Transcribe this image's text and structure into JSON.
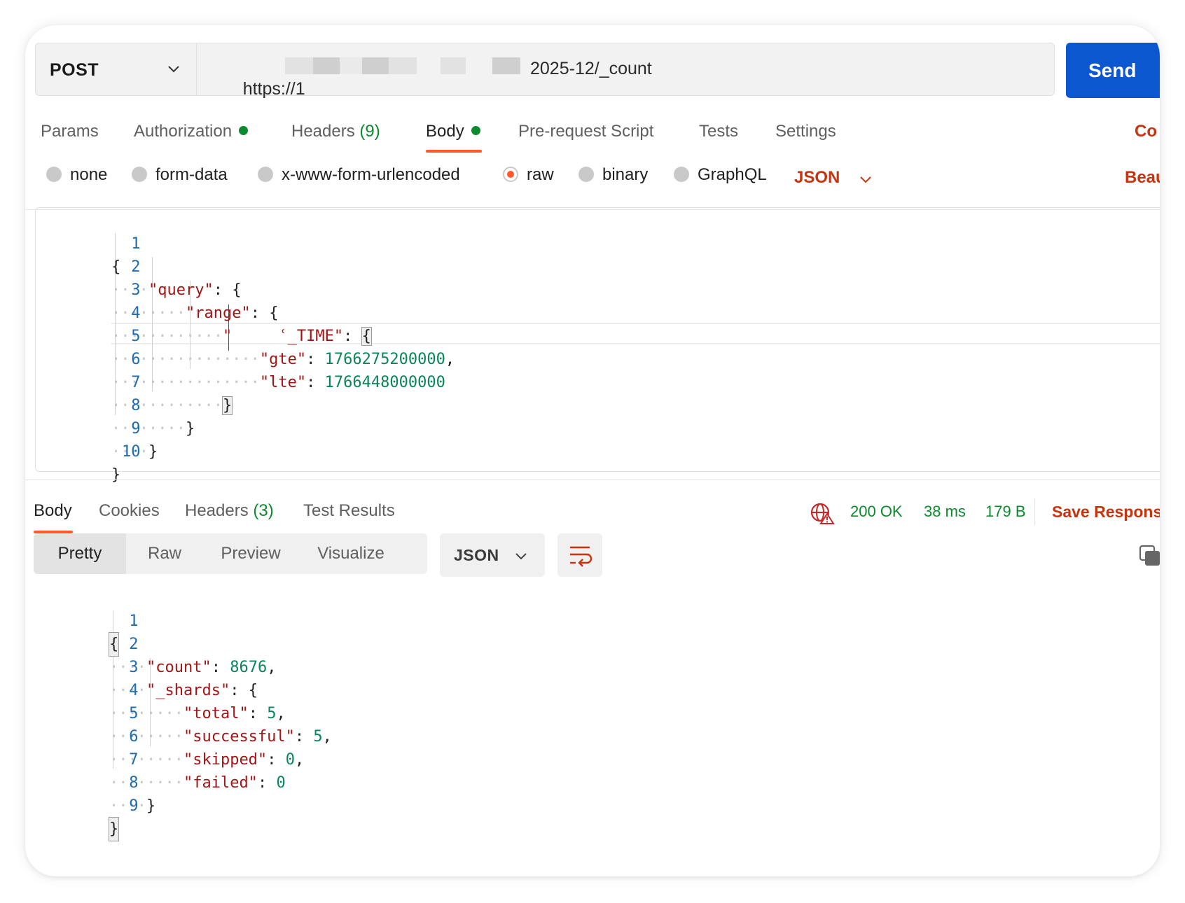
{
  "request": {
    "method": "POST",
    "url_start": "https://1",
    "url_end": "2025-12/_count",
    "send_label": "Send"
  },
  "request_tabs": {
    "params": "Params",
    "authorization": "Authorization",
    "headers": "Headers",
    "headers_count": "(9)",
    "body": "Body",
    "pre_request": "Pre-request Script",
    "tests": "Tests",
    "settings": "Settings",
    "cookies_link": "Co"
  },
  "body_types": {
    "none": "none",
    "form_data": "form-data",
    "urlencoded": "x-www-form-urlencoded",
    "raw": "raw",
    "binary": "binary",
    "graphql": "GraphQL",
    "format": "JSON",
    "beautify": "Beau"
  },
  "request_body": {
    "line_numbers": [
      "1",
      "2",
      "3",
      "4",
      "5",
      "6",
      "7",
      "8",
      "9",
      "10"
    ],
    "open_brace": "{",
    "close_brace": "}",
    "query_key": "\"query\"",
    "range_key": "\"range\"",
    "field_key_start": "\"",
    "field_key_end": "ʿ_TIME\"",
    "gte_key": "\"gte\"",
    "gte_value": "1766275200000",
    "lte_key": "\"lte\"",
    "lte_value": "1766448000000"
  },
  "response_tabs": {
    "body": "Body",
    "cookies": "Cookies",
    "headers": "Headers",
    "headers_count": "(3)",
    "test_results": "Test Results"
  },
  "response_status": {
    "code": "200 OK",
    "time": "38 ms",
    "size": "179 B",
    "save": "Save Respons"
  },
  "response_view": {
    "pretty": "Pretty",
    "raw": "Raw",
    "preview": "Preview",
    "visualize": "Visualize",
    "format": "JSON"
  },
  "response_body": {
    "line_numbers": [
      "1",
      "2",
      "3",
      "4",
      "5",
      "6",
      "7",
      "8",
      "9"
    ],
    "count_key": "\"count\"",
    "count_value": "8676",
    "shards_key": "\"_shards\"",
    "total_key": "\"total\"",
    "total_value": "5",
    "successful_key": "\"successful\"",
    "successful_value": "5",
    "skipped_key": "\"skipped\"",
    "skipped_value": "0",
    "failed_key": "\"failed\"",
    "failed_value": "0"
  },
  "colors": {
    "accent_orange": "#ff5a2c",
    "send_blue": "#0b57d0",
    "success_green": "#0b8a2e",
    "json_key": "#a31515",
    "json_number": "#098658"
  }
}
